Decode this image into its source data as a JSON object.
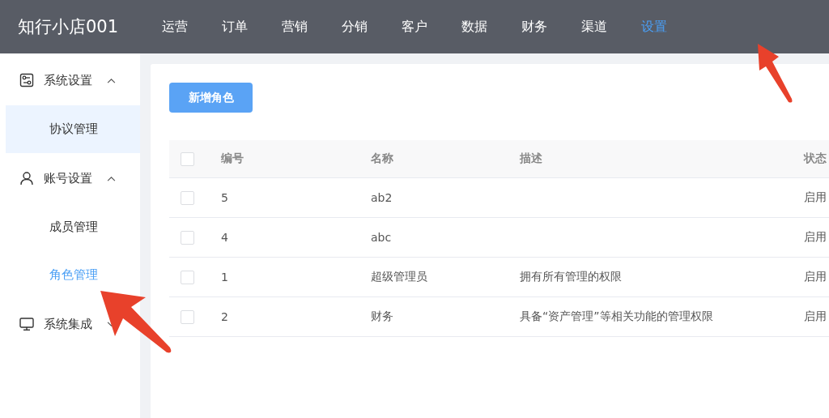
{
  "brand": "知行小店001",
  "nav": [
    {
      "label": "运营",
      "selected": false
    },
    {
      "label": "订单",
      "selected": false
    },
    {
      "label": "营销",
      "selected": false
    },
    {
      "label": "分销",
      "selected": false
    },
    {
      "label": "客户",
      "selected": false
    },
    {
      "label": "数据",
      "selected": false
    },
    {
      "label": "财务",
      "selected": false
    },
    {
      "label": "渠道",
      "selected": false
    },
    {
      "label": "设置",
      "selected": true
    }
  ],
  "sidebar": {
    "groups": [
      {
        "label": "系统设置",
        "expanded": true,
        "items": [
          {
            "label": "协议管理",
            "selected": false,
            "hovered": true
          }
        ]
      },
      {
        "label": "账号设置",
        "expanded": true,
        "items": [
          {
            "label": "成员管理",
            "selected": false,
            "hovered": false
          },
          {
            "label": "角色管理",
            "selected": true,
            "hovered": false
          }
        ]
      },
      {
        "label": "系统集成",
        "expanded": false
      }
    ]
  },
  "add_button": "新增角色",
  "table": {
    "header_checked": false,
    "columns": [
      "编号",
      "名称",
      "描述",
      "状态"
    ],
    "rows": [
      {
        "checked": false,
        "cells": [
          "5",
          "ab2",
          "",
          "启用"
        ]
      },
      {
        "checked": false,
        "cells": [
          "4",
          "abc",
          "",
          "启用"
        ]
      },
      {
        "checked": false,
        "cells": [
          "1",
          "超级管理员",
          "拥有所有管理的权限",
          "启用"
        ]
      },
      {
        "checked": false,
        "cells": [
          "2",
          "财务",
          "具备“资产管理”等相关功能的管理权限",
          "启用"
        ]
      }
    ]
  }
}
